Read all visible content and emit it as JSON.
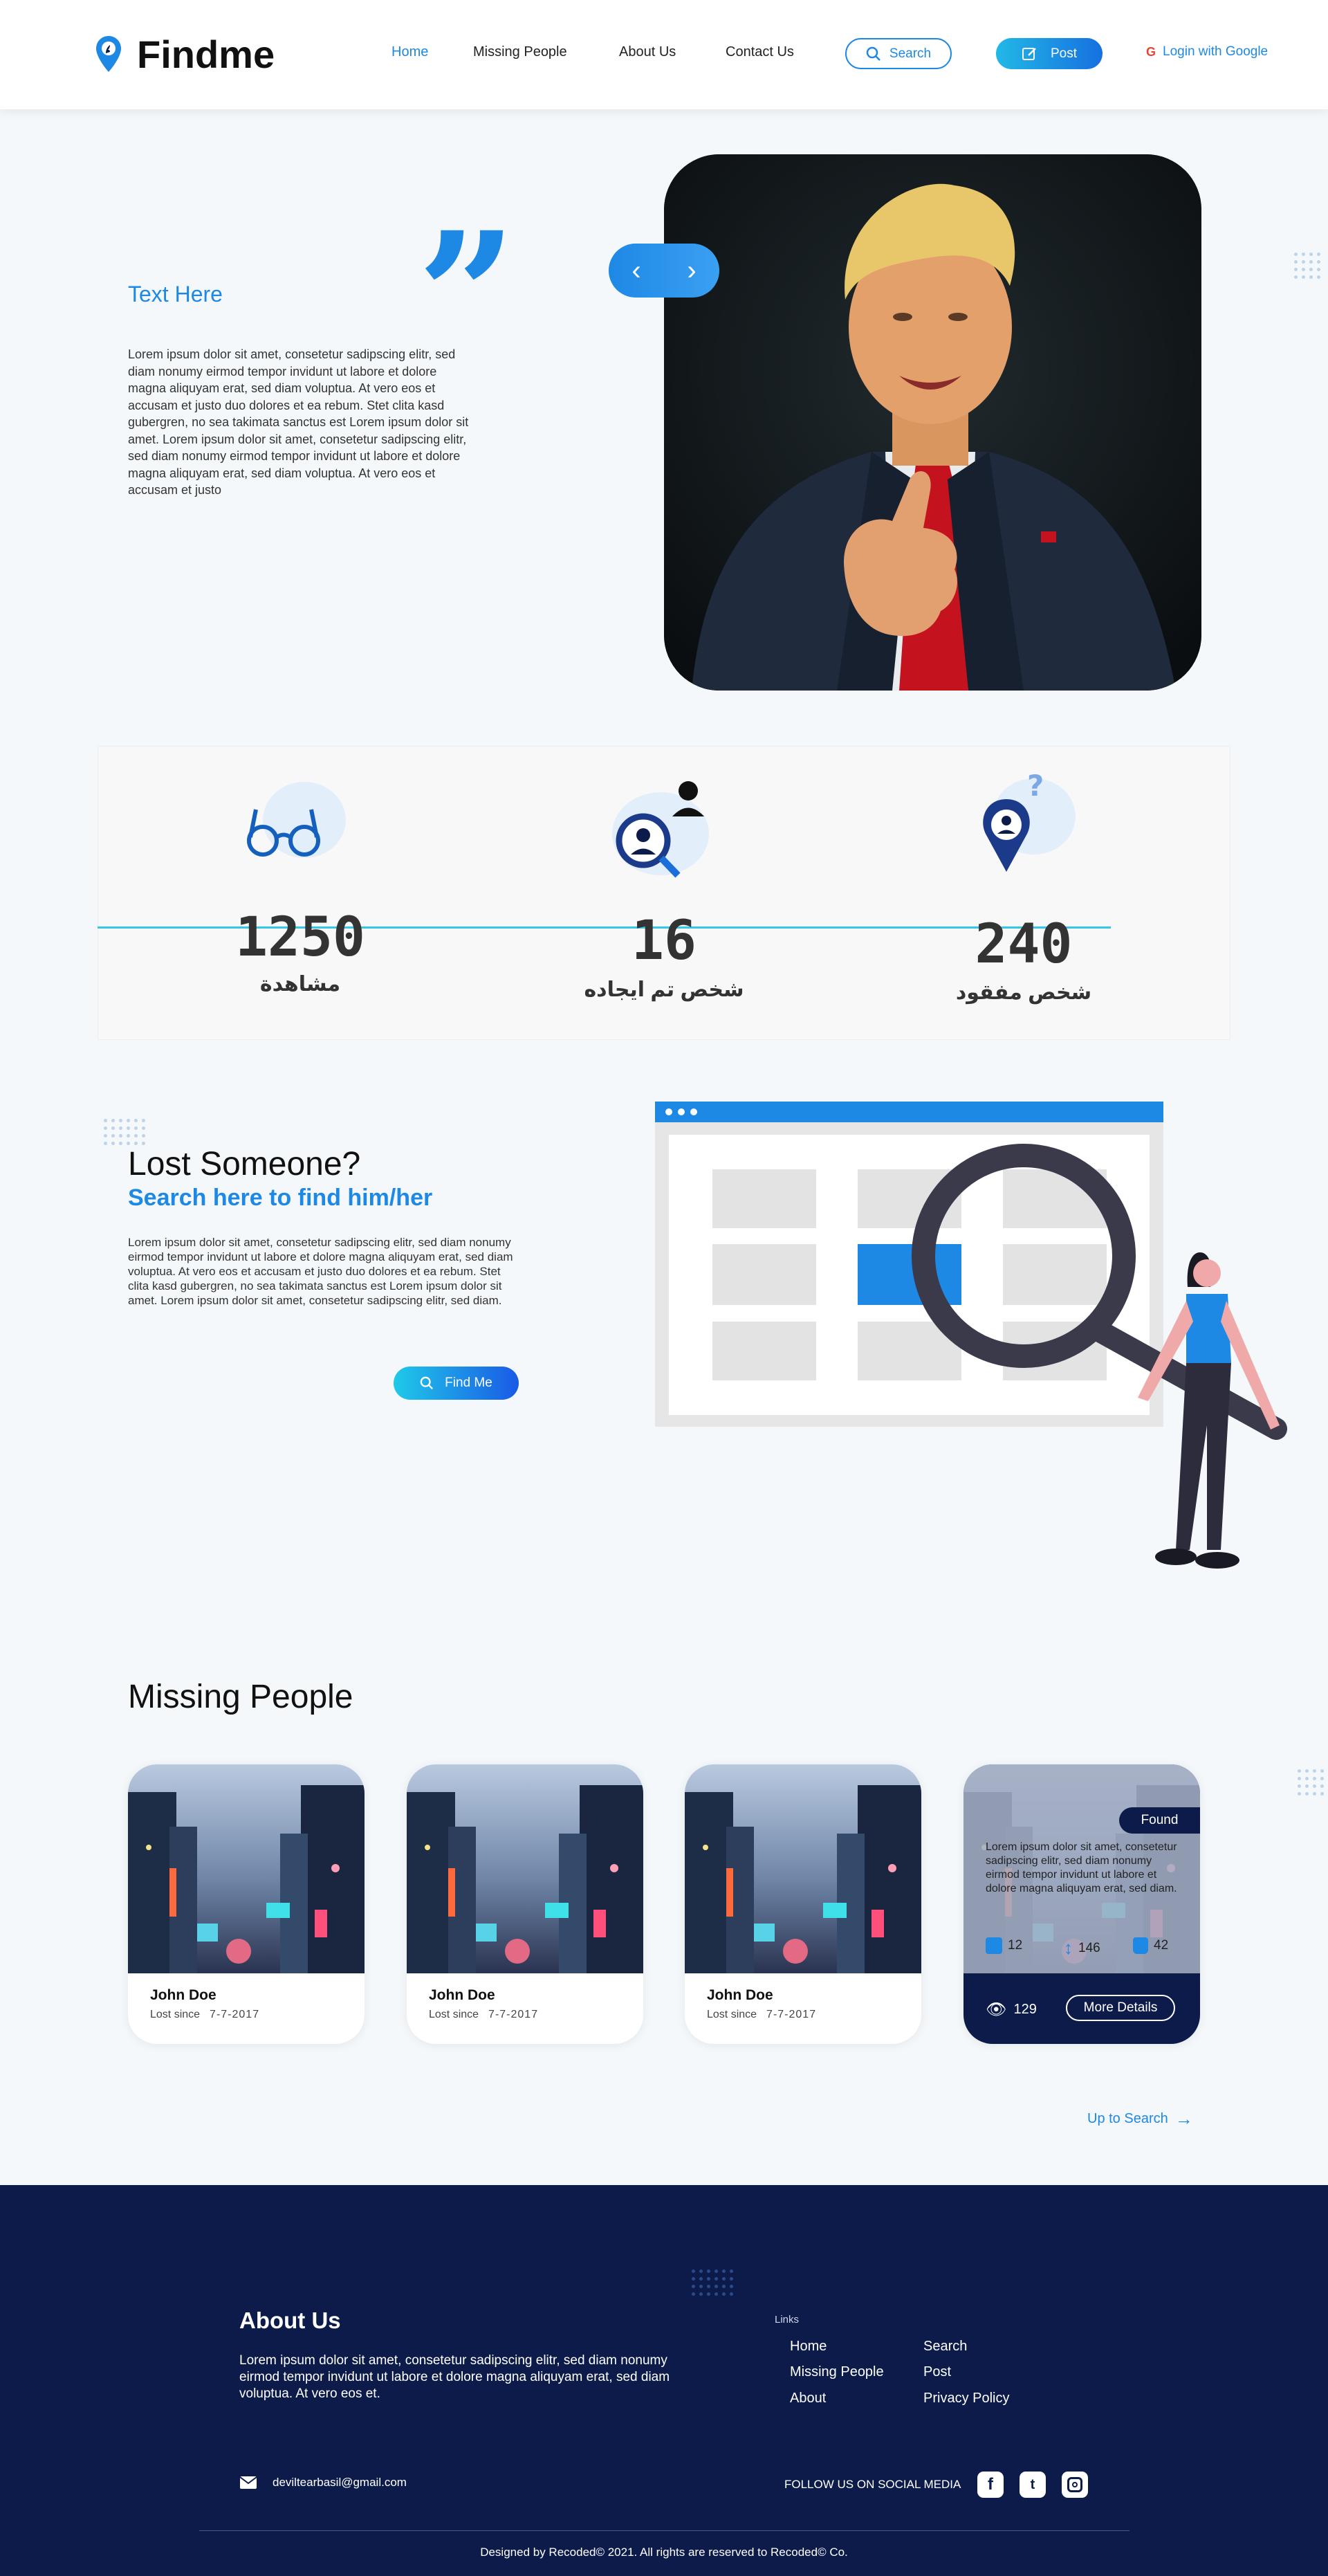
{
  "header": {
    "brand": "Findme",
    "nav": {
      "home": "Home",
      "missing": "Missing People",
      "about": "About Us",
      "contact": "Contact Us"
    },
    "search_label": "Search",
    "post_label": "Post",
    "login_label": "Login with Google",
    "accent": "#1e88e5"
  },
  "hero": {
    "title": "Text Here",
    "body": "Lorem ipsum dolor sit amet, consetetur sadipscing elitr, sed diam nonumy eirmod tempor invidunt ut labore et dolore magna aliquyam erat, sed diam voluptua. At vero eos et accusam et justo duo dolores et ea rebum. Stet clita kasd gubergren, no sea takimata sanctus est Lorem ipsum dolor sit amet. Lorem ipsum dolor sit amet, consetetur sadipscing elitr, sed diam nonumy eirmod tempor invidunt ut labore et dolore magna aliquyam erat, sed diam voluptua. At vero eos et accusam et justo"
  },
  "stats": [
    {
      "number": "1250",
      "label": "مشاهدة",
      "icon": "glasses-icon"
    },
    {
      "number": "16",
      "label": "شخص تم ايجاده",
      "icon": "person-found-icon"
    },
    {
      "number": "240",
      "label": "شخص مفقود",
      "icon": "person-missing-icon"
    }
  ],
  "lost": {
    "title": "Lost Someone?",
    "subtitle": "Search here to find him/her",
    "body": "Lorem ipsum dolor sit amet, consetetur sadipscing elitr, sed diam nonumy eirmod tempor invidunt ut labore et dolore magna aliquyam erat, sed diam voluptua. At vero eos et accusam et justo duo dolores et ea rebum. Stet clita kasd gubergren, no sea takimata sanctus est Lorem ipsum dolor sit amet. Lorem ipsum dolor sit amet, consetetur sadipscing elitr, sed diam.",
    "button": "Find Me"
  },
  "missing": {
    "title": "Missing People",
    "cards": [
      {
        "name": "John Doe",
        "lost_label": "Lost since",
        "date": "7-7-2017"
      },
      {
        "name": "John Doe",
        "lost_label": "Lost since",
        "date": "7-7-2017"
      },
      {
        "name": "John Doe",
        "lost_label": "Lost since",
        "date": "7-7-2017"
      }
    ],
    "featured": {
      "badge": "Found",
      "text": "Lorem ipsum dolor sit amet, consetetur sadipscing elitr, sed diam nonumy eirmod tempor invidunt ut labore et dolore magna aliquyam erat, sed diam.",
      "age": "12",
      "height": "146",
      "weight": "42",
      "views": "129",
      "details_button": "More Details"
    },
    "up_link": "Up to Search"
  },
  "footer": {
    "about_title": "About Us",
    "about_body": "Lorem ipsum dolor sit amet, consetetur sadipscing elitr, sed diam nonumy eirmod tempor invidunt ut labore et dolore magna aliquyam erat, sed diam voluptua. At vero eos et.",
    "links_title": "Links",
    "links_col1": [
      "Home",
      "Missing People",
      "About"
    ],
    "links_col2": [
      "Search",
      "Post",
      "Privacy Policy"
    ],
    "email": "deviltearbasil@gmail.com",
    "follow": "FOLLOW US ON SOCIAL MEDIA",
    "copyright": "Designed by Recoded© 2021. All rights are reserved to Recoded© Co.",
    "background": "#0d1b4b"
  }
}
